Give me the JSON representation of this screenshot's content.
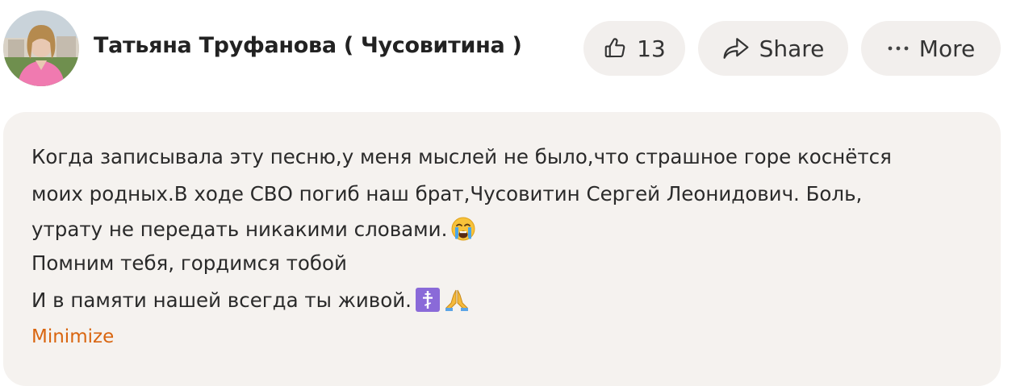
{
  "author": {
    "name": "Татьяна Труфанова ( Чусовитина )"
  },
  "actions": {
    "like_count": "13",
    "share_label": "Share",
    "more_label": "More"
  },
  "post": {
    "lines": [
      "Когда записывала эту песню,у меня мыслей не было,что страшное горе коснётся",
      "моих родных.В ходе СВО погиб наш брат,Чусовитин Сергей Леонидович. Боль,",
      "утрату не передать никакими словами.",
      "Помним тебя, гордимся тобой",
      "И в памяти нашей всегда ты живой."
    ],
    "emojis": [
      "crying-face-emoji",
      "orthodox-cross-emoji",
      "praying-hands-emoji"
    ]
  },
  "minimize_label": "Minimize",
  "colors": {
    "pill_bg": "#f2efed",
    "card_bg": "#f5f2ef",
    "accent": "#d9650f"
  }
}
